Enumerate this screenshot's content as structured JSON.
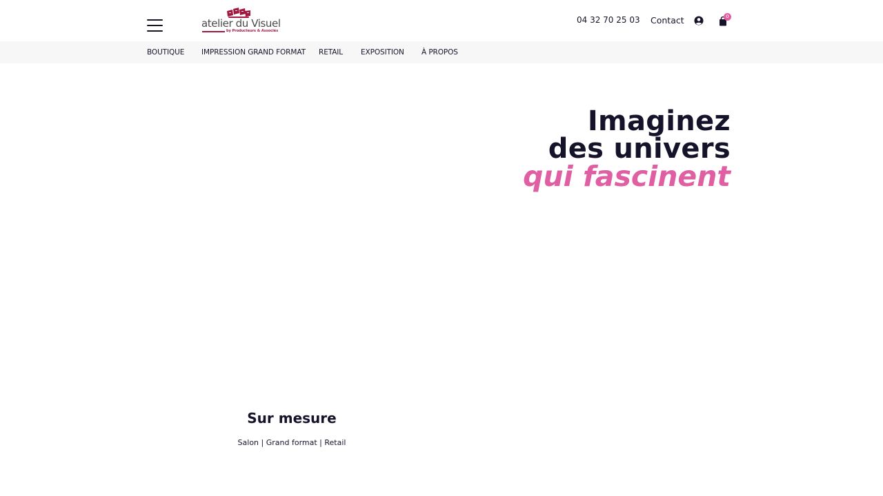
{
  "header": {
    "logo": {
      "name": "atelier du Visuel",
      "tagline": "by Producteurs & Associés",
      "colors": {
        "brand": "#a3173f",
        "text": "#4a4a4a"
      }
    },
    "phone": "04 32 70 25 03",
    "contact_label": "Contact",
    "cart_count": "0",
    "icons": [
      "hamburger-menu-icon",
      "user-account-icon",
      "shopping-bag-icon"
    ]
  },
  "nav": {
    "items": [
      {
        "label": "BOUTIQUE"
      },
      {
        "label": "IMPRESSION GRAND FORMAT"
      },
      {
        "label": "RETAIL"
      },
      {
        "label": "EXPOSITION"
      },
      {
        "label": "À PROPOS"
      }
    ]
  },
  "hero": {
    "line1": "Imaginez",
    "line2": "des univers",
    "accent": "qui fascinent"
  },
  "card": {
    "title": "Sur mesure",
    "subtitle": "Salon | Grand format | Retail"
  },
  "colors": {
    "text": "#14132a",
    "accent": "#e05fa2",
    "nav_background": "#f7f7f7",
    "background": "#ffffff"
  }
}
